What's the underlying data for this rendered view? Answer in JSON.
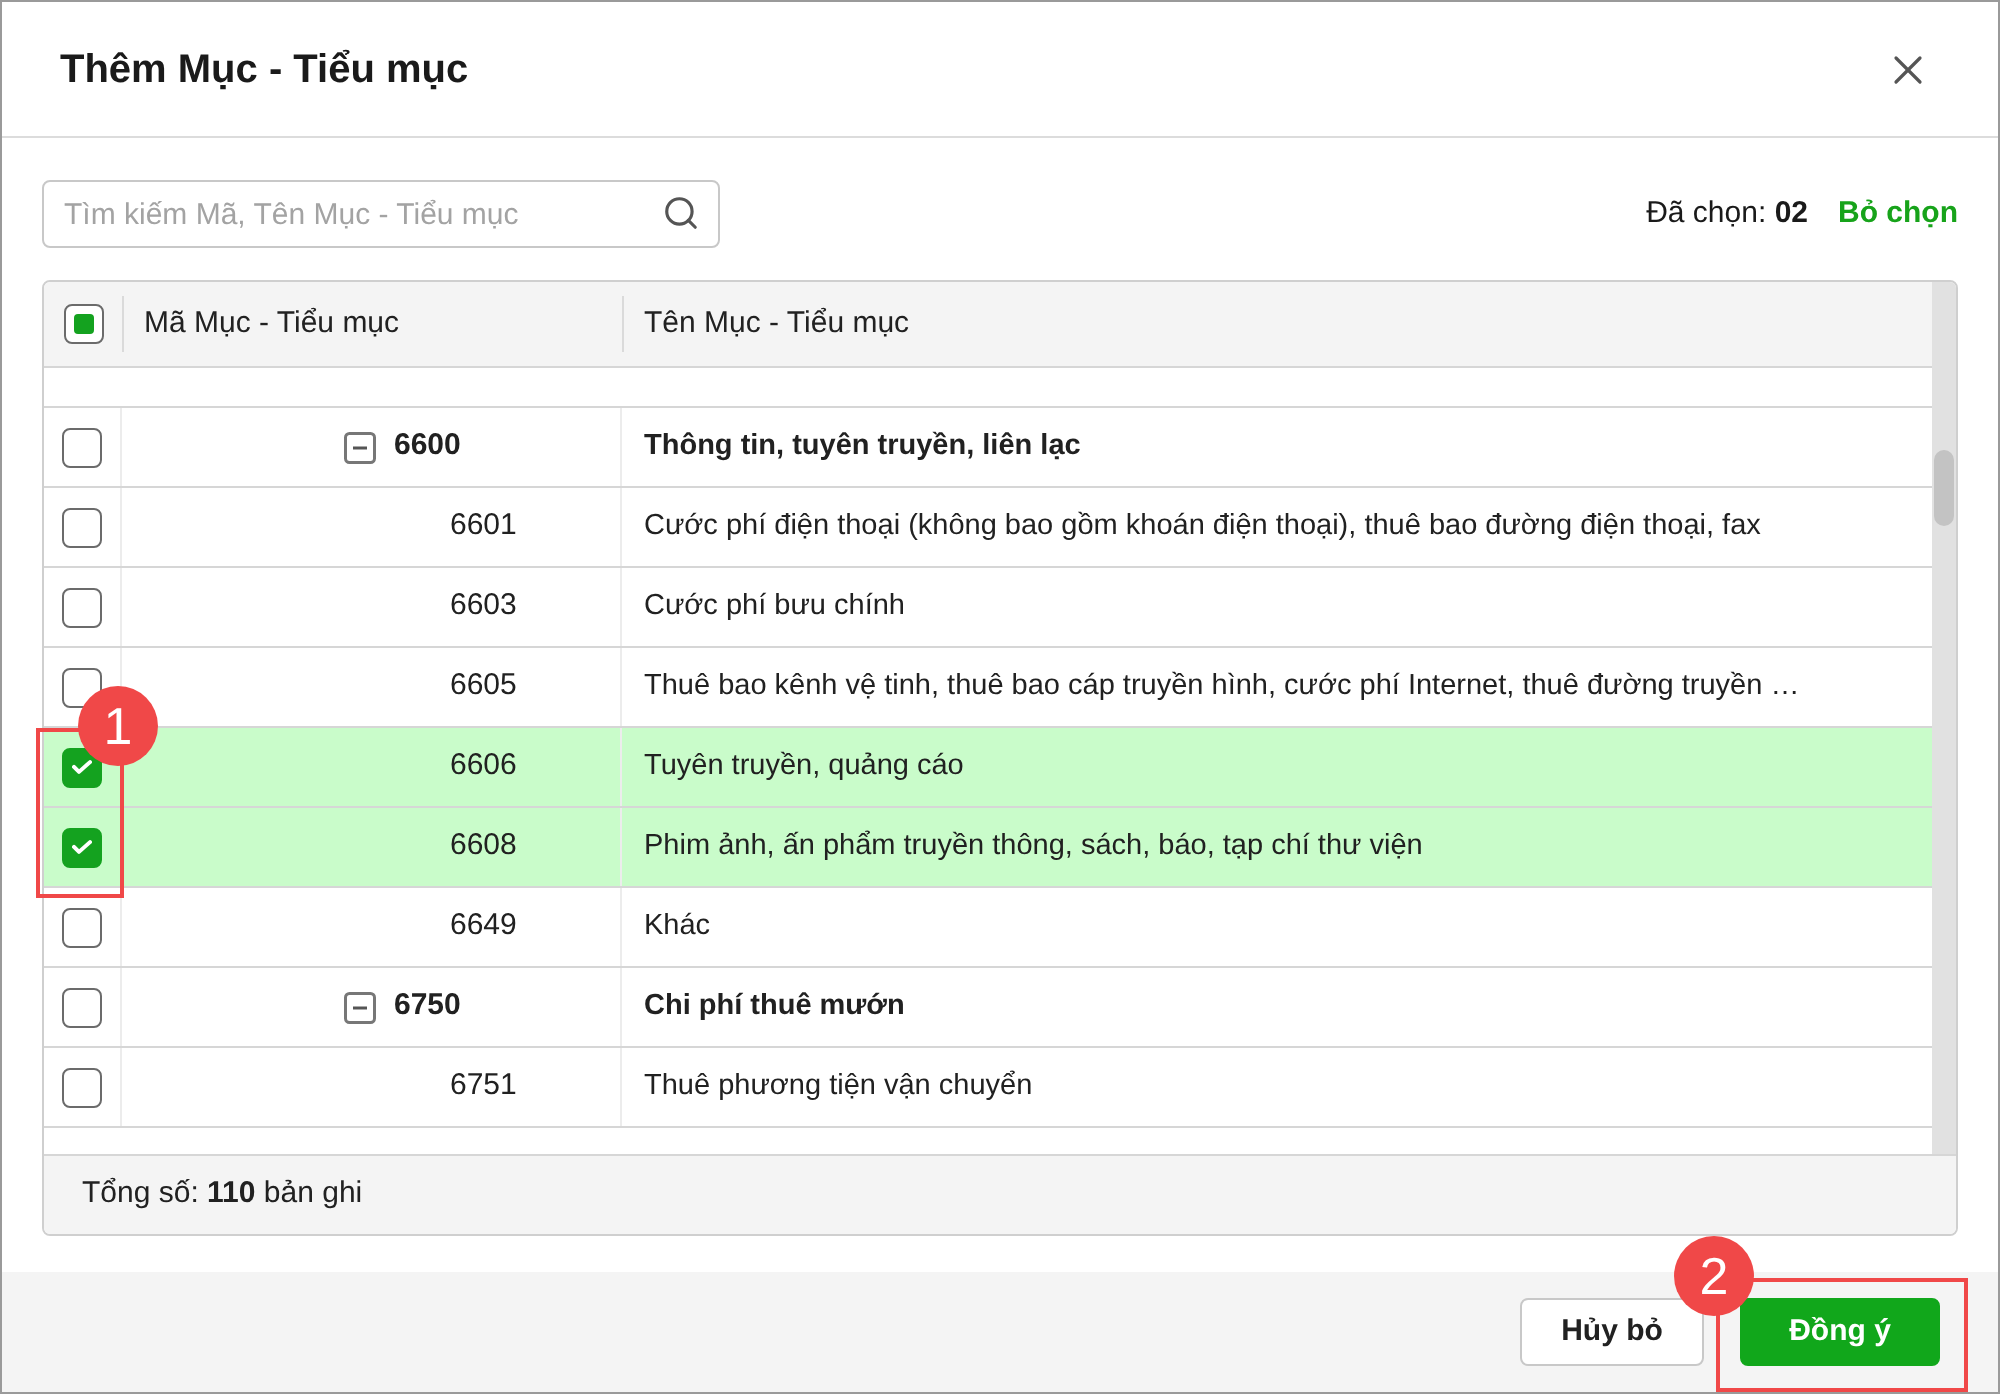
{
  "window": {
    "title": "Thêm Mục - Tiểu mục"
  },
  "search": {
    "placeholder": "Tìm kiếm Mã, Tên Mục - Tiểu mục"
  },
  "selection": {
    "summary": "Đã chọn: **02**",
    "clear_link": "Bỏ chọn"
  },
  "table": {
    "select_all": {
      "checked": false,
      "indeterminate": true
    },
    "columns": [
      "Mã Mục - Tiểu mục",
      "Tên Mục - Tiểu mục"
    ],
    "rows": [
      {
        "code": "6600",
        "name": "Thông tin, tuyên truyền, liên lạc",
        "expanded": true,
        "checked": false,
        "children": [
          {
            "code": "6601",
            "name": "Cước phí điện thoại (không bao gồm khoán điện thoại), thuê bao đường điện thoại, fax",
            "checked": false
          },
          {
            "code": "6603",
            "name": "Cước phí bưu chính",
            "checked": false
          },
          {
            "code": "6605",
            "name": "Thuê bao kênh vệ tinh, thuê bao cáp truyền hình, cước phí Internet, thuê đường truyền …",
            "checked": false
          },
          {
            "code": "6606",
            "name": "Tuyên truyền, quảng cáo",
            "checked": true
          },
          {
            "code": "6608",
            "name": "Phim ảnh, ấn phẩm truyền thông, sách, báo, tạp chí thư viện",
            "checked": true
          },
          {
            "code": "6649",
            "name": "Khác",
            "checked": false
          }
        ]
      },
      {
        "code": "6750",
        "name": "Chi phí thuê mướn",
        "expanded": true,
        "checked": false,
        "children": [
          {
            "code": "6751",
            "name": "Thuê phương tiện vận chuyển",
            "checked": false
          }
        ]
      }
    ],
    "total": "Tổng số: **110** bản ghi"
  },
  "buttons": [
    {
      "label": "Hủy bỏ",
      "kind": "secondary"
    },
    {
      "label": "Đồng ý",
      "kind": "primary"
    }
  ],
  "annotations": [
    {
      "label": "1"
    },
    {
      "label": "2"
    }
  ]
}
